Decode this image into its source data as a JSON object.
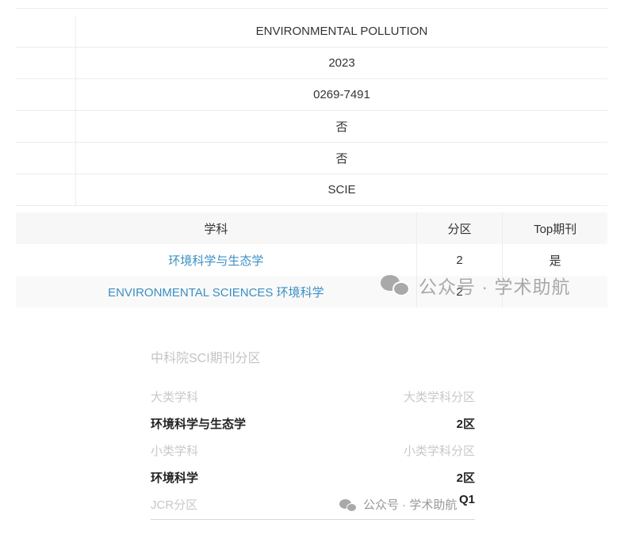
{
  "journal_info": {
    "rows": [
      {
        "value": "ENVIRONMENTAL POLLUTION"
      },
      {
        "value": "2023"
      },
      {
        "value": "0269-7491"
      },
      {
        "value": "否"
      },
      {
        "value": "否"
      },
      {
        "value": "SCIE"
      }
    ]
  },
  "subject_table": {
    "headers": {
      "subject": "学科",
      "zone": "分区",
      "top": "Top期刊"
    },
    "rows": [
      {
        "subject": "环境科学与生态学",
        "zone": "2",
        "top": "是"
      },
      {
        "subject": "ENVIRONMENTAL SCIENCES 环境科学",
        "zone": "2",
        "top": ""
      }
    ]
  },
  "watermark": {
    "text": "公众号 · 学术助航",
    "icon": "wechat-icon"
  },
  "cas_block": {
    "title": "中科院SCI期刊分区",
    "major_label": "大类学科",
    "major_zone_label": "大类学科分区",
    "major_subject": "环境科学与生态学",
    "major_zone": "2区",
    "minor_label": "小类学科",
    "minor_zone_label": "小类学科分区",
    "minor_subject": "环境科学",
    "minor_zone": "2区",
    "jcr_label": "JCR分区",
    "jcr_value": "Q1"
  }
}
